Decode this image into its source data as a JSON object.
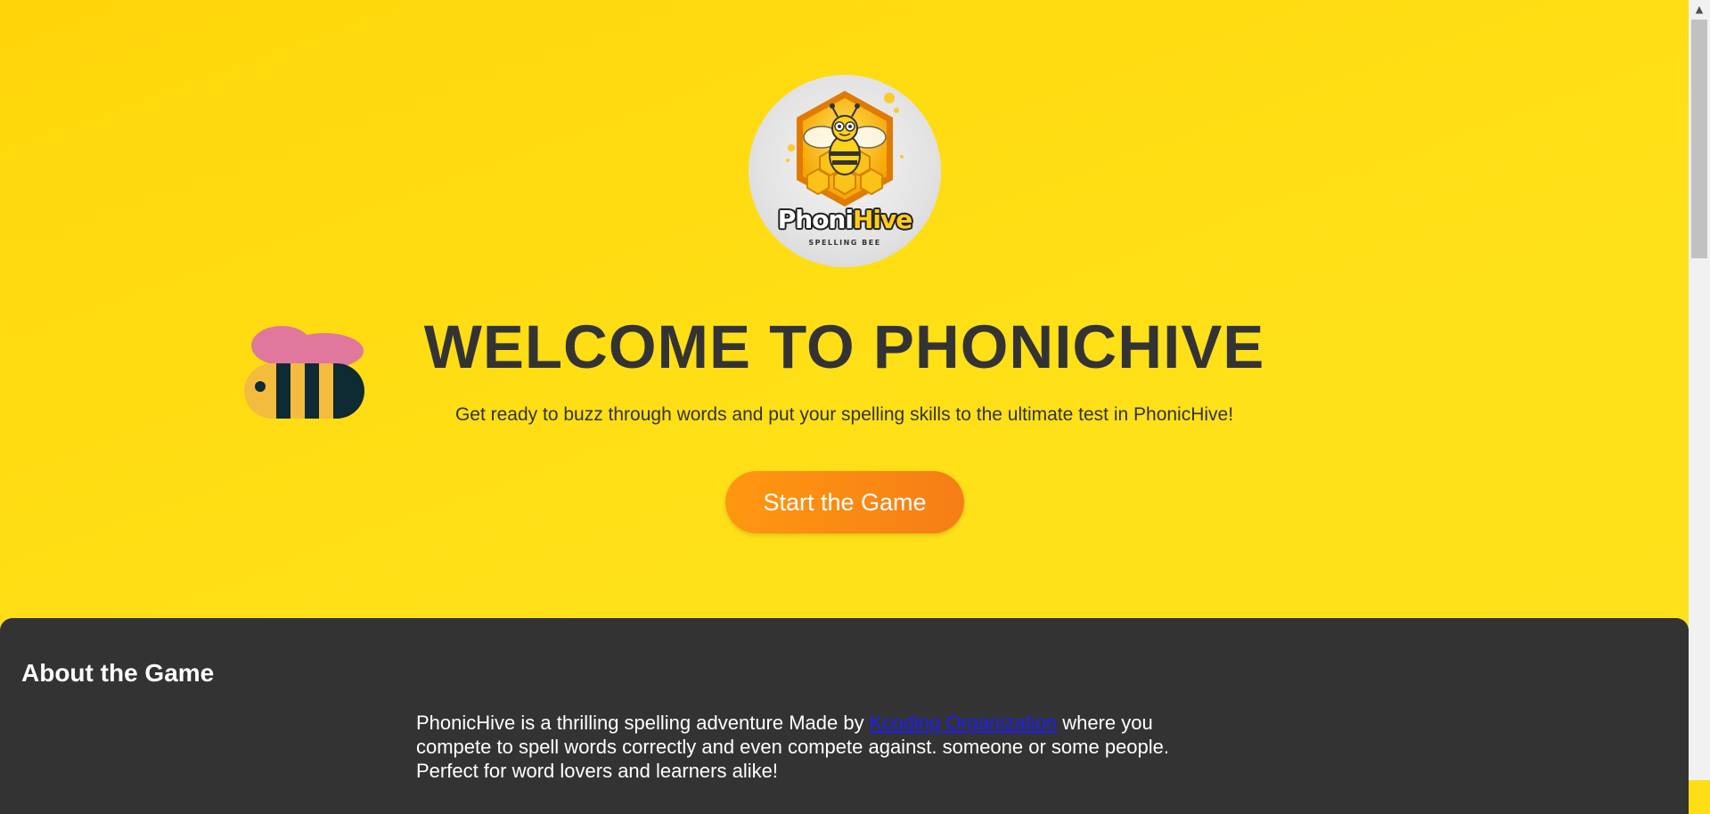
{
  "logo": {
    "title_part1": "Phoni",
    "title_part2": "Hive",
    "subtitle": "SPELLING BEE"
  },
  "hero": {
    "title": "WELCOME TO PHONICHIVE",
    "subtitle": "Get ready to buzz through words and put your spelling skills to the ultimate test in PhonicHive!",
    "start_button": "Start the Game"
  },
  "about": {
    "title": "About the Game",
    "text_before": "PhonicHive is a thrilling spelling adventure Made by ",
    "link_text": "Kcoding Organization",
    "text_after": " where you compete to spell words correctly and even compete against. someone or some people. Perfect for word lovers and learners alike!"
  },
  "scrollbar": {
    "up_arrow": "▲"
  },
  "icons": [
    "logo-image",
    "bee-icon",
    "scroll-up-icon"
  ],
  "colors": {
    "background": "#ffd60a",
    "heading": "#333333",
    "button": "#ff9710",
    "about_background": "#333333",
    "link": "#1d1dff"
  }
}
